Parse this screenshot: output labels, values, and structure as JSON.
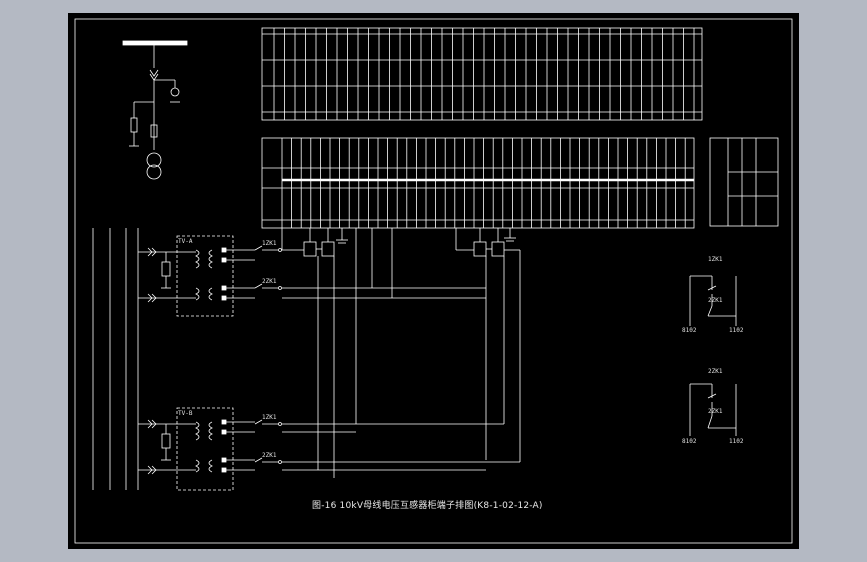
{
  "drawing": {
    "caption": "图-16 10kV母线电压互感器柜端子排图(K8-1-02-12-A)"
  },
  "panels": {
    "vt_a": "TV-A",
    "vt_b": "TV-B",
    "sw_a1": "1ZK1",
    "sw_a2": "2ZK1",
    "sw_b1": "1ZK1",
    "sw_b2": "2ZK1",
    "ann_a": "1ZK1",
    "ann_a2": "2ZK1",
    "ann_b": "2ZK1",
    "ann_b2": "2ZK1",
    "term_a_left": "8102",
    "term_a_right": "1102",
    "term_b_left": "8102",
    "term_b_right": "1102"
  },
  "colors": {
    "background": "#b4b9c3",
    "sheet": "#000000",
    "line": "#ffffff",
    "text": "#e0e0e0"
  }
}
